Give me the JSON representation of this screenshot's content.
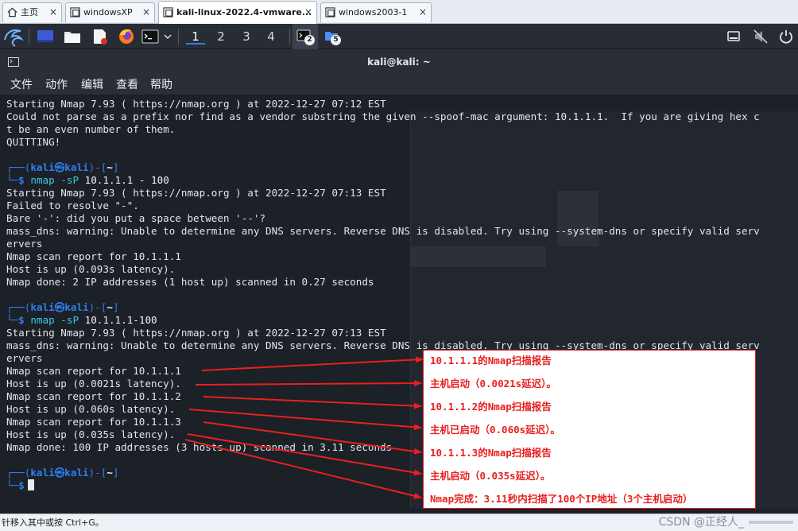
{
  "vm_tabs": [
    {
      "label": "主页",
      "active": false
    },
    {
      "label": "windowsXP",
      "active": false
    },
    {
      "label": "kali-linux-2022.4-vmware...",
      "active": true
    },
    {
      "label": "windows2003-1",
      "active": false
    }
  ],
  "tab_close_glyph": "×",
  "panel": {
    "workspaces": [
      "1",
      "2",
      "3",
      "4"
    ],
    "current_workspace": "1",
    "terminal_badge": "2",
    "files_badge": "5"
  },
  "window": {
    "title": "kali@kali: ~",
    "menu": [
      "文件",
      "动作",
      "编辑",
      "查看",
      "帮助"
    ]
  },
  "prompt": {
    "open": "┌──(",
    "user": "kali",
    "skull": "㉿",
    "host": "kali",
    "close": ")-[",
    "dir": "~",
    "end": "]",
    "second": "└─",
    "dollar": "$"
  },
  "terminal": {
    "l0": "Starting Nmap 7.93 ( https://nmap.org ) at 2022-12-27 07:12 EST",
    "l1": "Could not parse as a prefix nor find as a vendor substring the given --spoof-mac argument: 10.1.1.1.  If you are giving hex c",
    "l2": "t be an even number of them.",
    "l3": "QUITTING!",
    "cmd1_name": "nmap",
    "cmd1_flag": "-sP",
    "cmd1_arg": "10.1.1.1 - 100",
    "l7": "Starting Nmap 7.93 ( https://nmap.org ) at 2022-12-27 07:13 EST",
    "l8": "Failed to resolve \"-\".",
    "l9": "Bare '-': did you put a space between '--'?",
    "l10": "mass_dns: warning: Unable to determine any DNS servers. Reverse DNS is disabled. Try using --system-dns or specify valid serv",
    "l11": "ervers",
    "l12": "Nmap scan report for 10.1.1.1",
    "l13": "Host is up (0.093s latency).",
    "l14": "Nmap done: 2 IP addresses (1 host up) scanned in 0.27 seconds",
    "cmd2_name": "nmap",
    "cmd2_flag": "-sP",
    "cmd2_arg": "10.1.1.1-100",
    "l18": "Starting Nmap 7.93 ( https://nmap.org ) at 2022-12-27 07:13 EST",
    "l19": "mass_dns: warning: Unable to determine any DNS servers. Reverse DNS is disabled. Try using --system-dns or specify valid serv",
    "l20": "ervers",
    "l21": "Nmap scan report for 10.1.1.1",
    "l22": "Host is up (0.0021s latency).",
    "l23": "Nmap scan report for 10.1.1.2",
    "l24": "Host is up (0.060s latency).",
    "l25": "Nmap scan report for 10.1.1.3",
    "l26": "Host is up (0.035s latency).",
    "l27": "Nmap done: 100 IP addresses (3 hosts up) scanned in 3.11 seconds"
  },
  "annotations": [
    "10.1.1.1的Nmap扫描报告",
    "主机启动（0.0021s延迟）。",
    "10.1.1.2的Nmap扫描报告",
    "主机已启动（0.060s延迟）。",
    "10.1.1.3的Nmap扫描报告",
    "主机启动（0.035s延迟）。",
    "Nmap完成：3.11秒内扫描了100个IP地址（3个主机启动）"
  ],
  "status": {
    "text": "针移入其中或按 Ctrl+G。",
    "watermark": "CSDN @正经人_"
  },
  "colors": {
    "prompt": "#2f7ef0",
    "command": "#3cc7e6",
    "annotation": "#e8201e",
    "terminal_bg": "#1c2027"
  }
}
